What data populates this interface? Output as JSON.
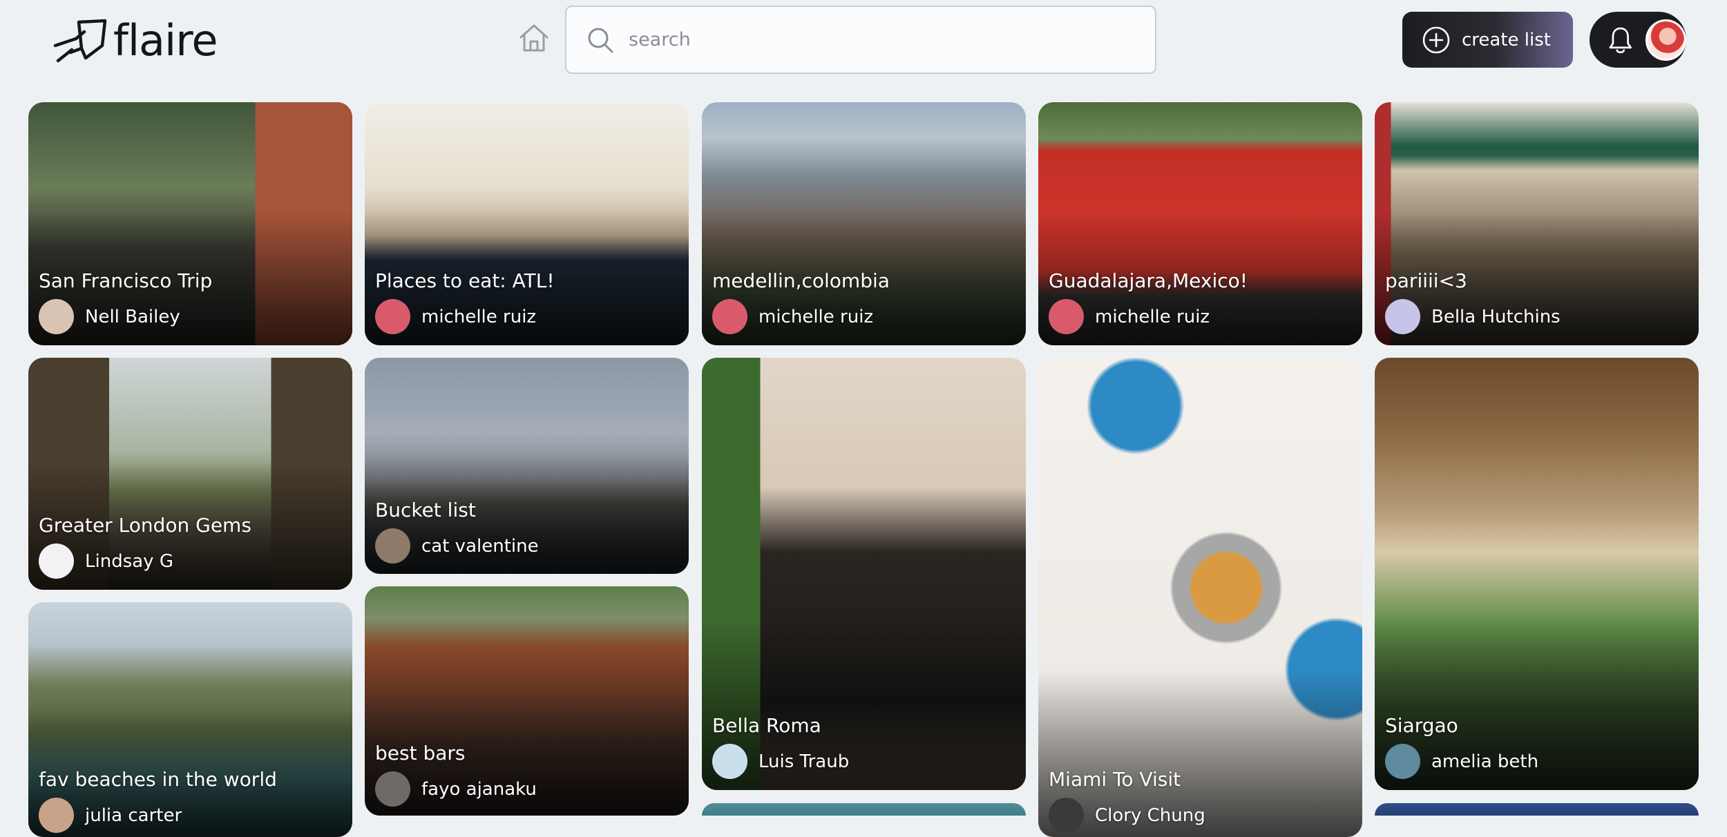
{
  "brand": {
    "name": "flaire"
  },
  "search": {
    "placeholder": "search",
    "value": ""
  },
  "actions": {
    "create_list_label": "create list"
  },
  "icons": {
    "logo": "rocket-logo-icon",
    "home": "home-icon",
    "search": "search-icon",
    "create": "plus-circle-icon",
    "notifications": "bell-icon",
    "profile": "avatar"
  },
  "lists": [
    {
      "title": "San Francisco Trip",
      "owner": "Nell Bailey",
      "avatar_color": "#d9c3b2"
    },
    {
      "title": "Places to eat: ATL!",
      "owner": "michelle ruiz",
      "avatar_color": "#d95b6b"
    },
    {
      "title": "medellin,colombia",
      "owner": "michelle ruiz",
      "avatar_color": "#d95b6b"
    },
    {
      "title": "Guadalajara,Mexico!",
      "owner": "michelle ruiz",
      "avatar_color": "#d95b6b"
    },
    {
      "title": "pariiii<3",
      "owner": "Bella Hutchins",
      "avatar_color": "#c6c4e8"
    },
    {
      "title": "Greater London Gems",
      "owner": "Lindsay G",
      "avatar_color": "#f2f2f4"
    },
    {
      "title": "Bucket list",
      "owner": "cat valentine",
      "avatar_color": "#8d7a68"
    },
    {
      "title": "Bella Roma",
      "owner": "Luis Traub",
      "avatar_color": "#c9e0ec"
    },
    {
      "title": "Miami To Visit",
      "owner": "Clory Chung",
      "avatar_color": "#3a3a3a"
    },
    {
      "title": "Siargao",
      "owner": "amelia beth",
      "avatar_color": "#5f8aa0"
    },
    {
      "title": "fav beaches in the world",
      "owner": "julia carter",
      "avatar_color": "#c8a38a"
    },
    {
      "title": "best bars",
      "owner": "fayo ajanaku",
      "avatar_color": "#6f6a65"
    }
  ]
}
